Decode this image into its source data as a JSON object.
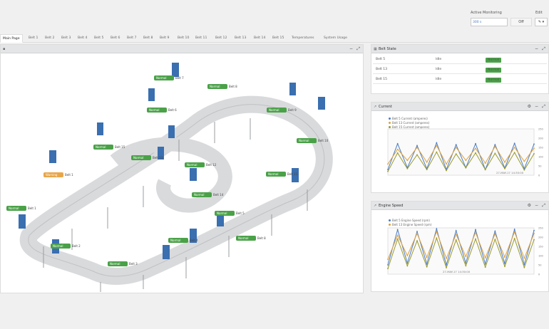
{
  "header": {
    "monitor_label": "Active Monitoring",
    "monitor_value": "300 s",
    "monitor_toggle": "Off",
    "edit_label": "Edit",
    "edit_button": "✎ ▾"
  },
  "tabs": [
    "Main Page",
    "Belt 1",
    "Belt 2",
    "Belt 3",
    "Belt 4",
    "Belt 5",
    "Belt 6",
    "Belt 7",
    "Belt 8",
    "Belt 9",
    "Belt 10",
    "Belt 11",
    "Belt 12",
    "Belt 13",
    "Belt 14",
    "Belt 15",
    "Temperatures",
    "System Usage"
  ],
  "main_panel": {
    "labels": [
      {
        "status": "Normal",
        "belt": "Belt 8"
      },
      {
        "status": "Normal",
        "belt": "Belt 9"
      },
      {
        "status": "Normal",
        "belt": "Belt 10"
      },
      {
        "status": "Normal",
        "belt": "Belt 11"
      },
      {
        "status": "Normal",
        "belt": "Belt 12"
      },
      {
        "status": "Normal",
        "belt": "Belt 13"
      },
      {
        "status": "Normal",
        "belt": "Belt 14"
      },
      {
        "status": "Normal",
        "belt": "Belt 15"
      },
      {
        "status": "Warning",
        "belt": "Belt 1"
      },
      {
        "status": "Normal",
        "belt": "Belt 1"
      },
      {
        "status": "Normal",
        "belt": "Belt 2"
      },
      {
        "status": "Normal",
        "belt": "Belt 3"
      },
      {
        "status": "Normal",
        "belt": "Belt 4"
      },
      {
        "status": "Normal",
        "belt": "Belt 5"
      },
      {
        "status": "Normal",
        "belt": "Belt 6"
      },
      {
        "status": "Normal",
        "belt": "Belt 7"
      },
      {
        "status": "Normal",
        "belt": "Belt 8"
      }
    ]
  },
  "belt_state": {
    "title": "Belt State",
    "rows": [
      {
        "belt": "Belt 5",
        "state": "Idle",
        "status": "Normal"
      },
      {
        "belt": "Belt 13",
        "state": "Idle",
        "status": "Normal"
      },
      {
        "belt": "Belt 15",
        "state": "Idle",
        "status": "Normal"
      }
    ]
  },
  "current": {
    "title": "Current",
    "timestamp": "27-MAY-17 14:25:00",
    "timestamp2": "27-MAY-17 14:30:00"
  },
  "engine": {
    "title": "Engine Speed",
    "timestamp": "27-MAY-17 14:25:00",
    "timestamp2": "27-MAY-17 14:30:00"
  },
  "colors": {
    "normal": "#4aa148",
    "warning": "#e8a64a",
    "blue": "#4a7cc9",
    "olive": "#9a9a2a",
    "gold": "#e0a13a"
  },
  "chart_data": [
    {
      "type": "line",
      "title": "Current",
      "series": [
        {
          "name": "Belt 5 Current (amperes)",
          "values": [
            30,
            170,
            40,
            160,
            35,
            175,
            30,
            165,
            40,
            170,
            30,
            165,
            38,
            172,
            35,
            168
          ]
        },
        {
          "name": "Belt 13 Current (amperes)",
          "values": [
            60,
            140,
            80,
            150,
            70,
            160,
            60,
            150,
            80,
            145,
            65,
            155,
            70,
            150,
            75,
            145
          ]
        },
        {
          "name": "Belt 15 Current (amperes)",
          "values": [
            20,
            120,
            35,
            110,
            30,
            125,
            25,
            115,
            40,
            120,
            30,
            118,
            35,
            122,
            28,
            116
          ]
        }
      ],
      "ylim": [
        0,
        250
      ],
      "yticks": [
        "0",
        "50",
        "100",
        "150",
        "200",
        "250"
      ]
    },
    {
      "type": "line",
      "title": "Engine Speed",
      "series": [
        {
          "name": "Belt 5 Engine Speed (rpm)",
          "values": [
            50,
            240,
            60,
            230,
            55,
            245,
            50,
            235,
            60,
            240,
            55,
            232,
            58,
            242,
            52,
            236
          ]
        },
        {
          "name": "Belt 13 Engine Speed (rpm)",
          "values": [
            80,
            210,
            100,
            220,
            90,
            230,
            85,
            215,
            95,
            225,
            88,
            218,
            92,
            228,
            86,
            220
          ]
        },
        {
          "name": "Belt 15 Engine Speed (rpm)",
          "values": [
            30,
            190,
            45,
            180,
            40,
            195,
            35,
            185,
            45,
            190,
            38,
            188,
            42,
            192,
            36,
            186
          ]
        }
      ],
      "ylim": [
        0,
        250
      ],
      "yticks": [
        "0",
        "50",
        "100",
        "150",
        "200",
        "250"
      ]
    }
  ]
}
